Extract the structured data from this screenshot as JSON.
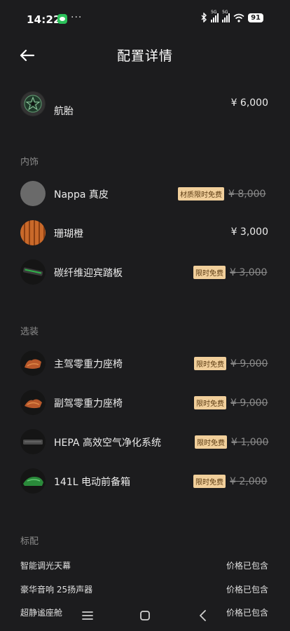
{
  "status_bar": {
    "time": "14:22",
    "dots": "···",
    "battery": "91",
    "signal_1": "5G",
    "signal_2": "5G"
  },
  "header": {
    "title": "配置详情"
  },
  "top_item": {
    "label": "航胎",
    "price": "¥ 6,000"
  },
  "interior": {
    "title": "内饰",
    "items": [
      {
        "label": "Nappa 真皮",
        "badge": "材质限时免费",
        "old_price": "¥ 8,000"
      },
      {
        "label": "珊瑚橙",
        "price": "¥ 3,000"
      },
      {
        "label": "碳纤维迎宾踏板",
        "badge": "限时免费",
        "old_price": "¥ 3,000"
      }
    ]
  },
  "options": {
    "title": "选装",
    "items": [
      {
        "label": "主驾零重力座椅",
        "badge": "限时免费",
        "old_price": "¥ 9,000"
      },
      {
        "label": "副驾零重力座椅",
        "badge": "限时免费",
        "old_price": "¥ 9,000"
      },
      {
        "label": "HEPA 高效空气净化系统",
        "badge": "限时免费",
        "old_price": "¥ 1,000"
      },
      {
        "label": "141L 电动前备箱",
        "badge": "限时免费",
        "old_price": "¥ 2,000"
      }
    ]
  },
  "standard": {
    "title": "标配",
    "items": [
      {
        "label": "智能调光天幕",
        "value": "价格已包含"
      },
      {
        "label": "豪华音响 25扬声器",
        "value": "价格已包含"
      },
      {
        "label": "超静谧座舱",
        "value": "价格已包含"
      }
    ]
  },
  "colors": {
    "background": "#1c1c1e",
    "badge_bg": "#f1cf9b",
    "badge_text": "#5c3b12",
    "coral_orange": "#c9692a"
  },
  "icons": {
    "back": "arrow-left-icon",
    "nav_menu": "menu-icon",
    "nav_home": "home-icon",
    "nav_back": "chevron-left-icon"
  }
}
